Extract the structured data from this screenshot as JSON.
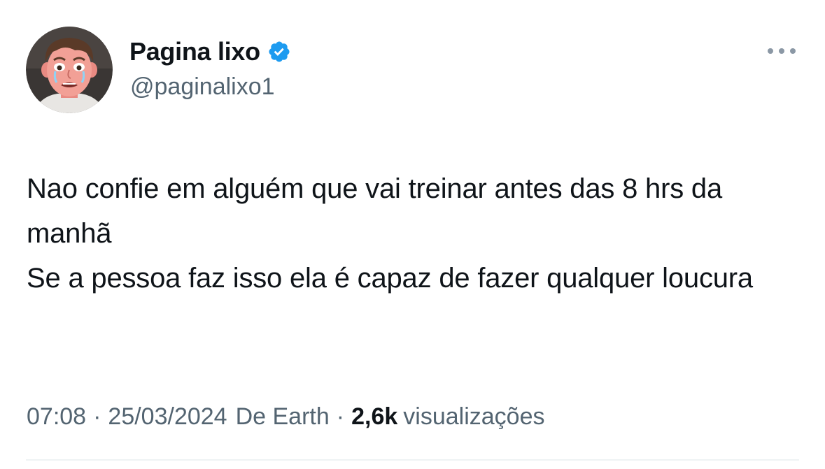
{
  "author": {
    "name": "Pagina lixo",
    "handle": "@paginalixo1",
    "verified": true,
    "verified_color": "#1d9bf0"
  },
  "tweet": {
    "lines": [
      "Nao confie em alguém que vai treinar antes das 8 hrs da manhã",
      "Se a pessoa faz isso ela é capaz de fazer qualquer loucura"
    ]
  },
  "meta": {
    "time": "07:08",
    "date": "25/03/2024",
    "source": "De Earth",
    "views_count": "2,6k",
    "views_label": "visualizações",
    "separator": "·"
  },
  "icons": {
    "avatar": "crying-man-avatar",
    "verified": "verified-badge-icon",
    "more": "more-icon"
  },
  "colors": {
    "text_primary": "#0f1419",
    "text_secondary": "#536471",
    "divider": "#eff3f4"
  }
}
